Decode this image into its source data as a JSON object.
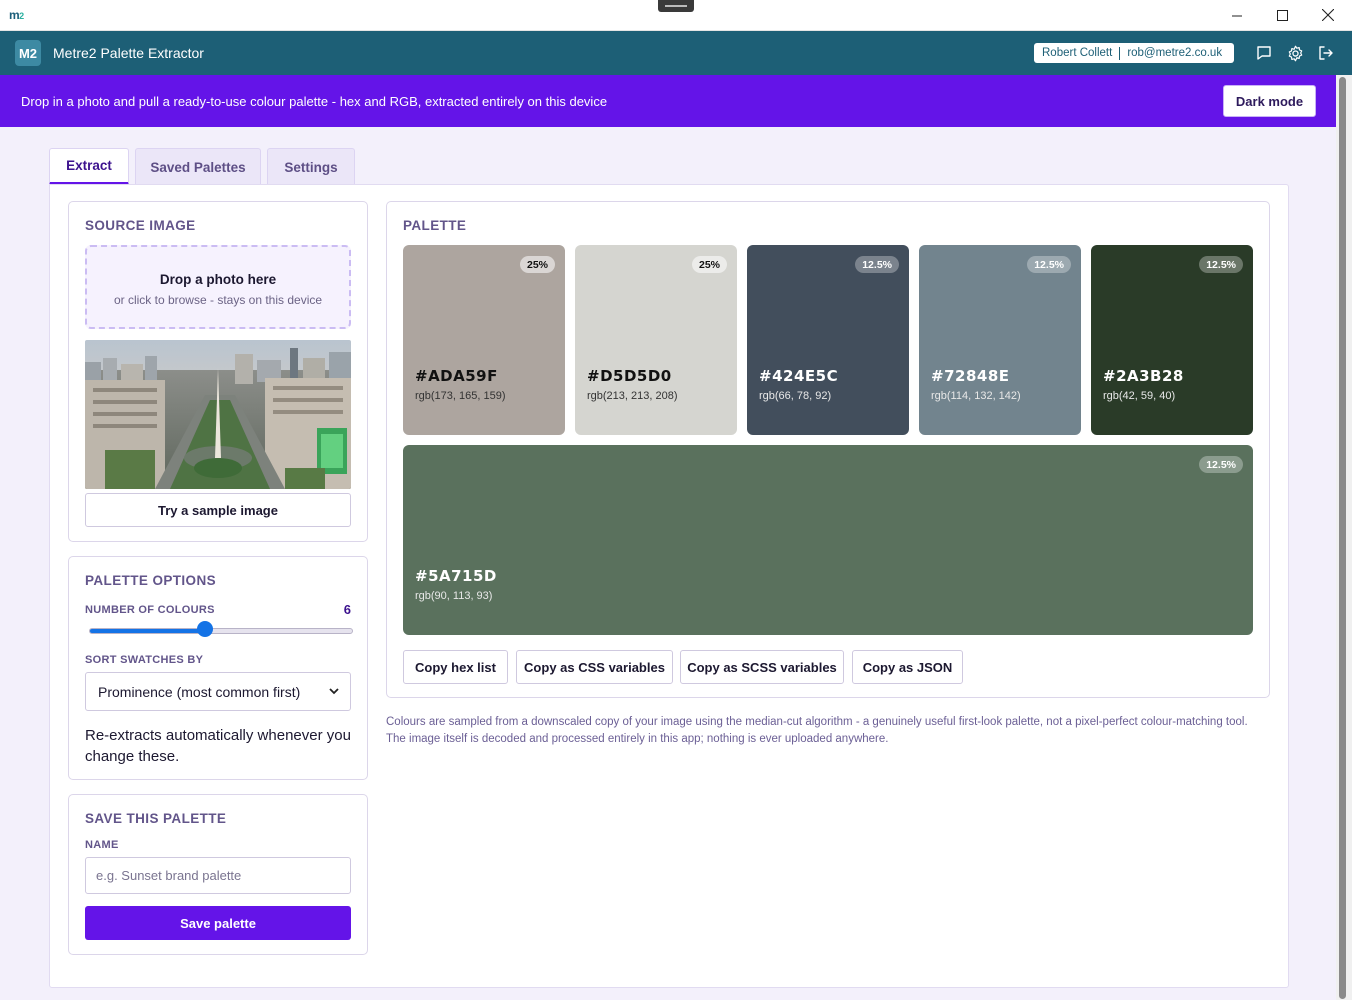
{
  "window": {
    "logo_main": "m",
    "logo_sub": "2"
  },
  "app": {
    "badge": "M2",
    "title": "Metre2 Palette Extractor"
  },
  "user": {
    "name": "Robert Collett",
    "email": "rob@metre2.co.uk"
  },
  "banner": {
    "text": "Drop in a photo and pull a ready-to-use colour palette - hex and RGB, extracted entirely on this device",
    "dark_mode_label": "Dark mode"
  },
  "tabs": [
    {
      "label": "Extract",
      "active": true
    },
    {
      "label": "Saved Palettes",
      "active": false
    },
    {
      "label": "Settings",
      "active": false
    }
  ],
  "source": {
    "title": "SOURCE IMAGE",
    "drop_title": "Drop a photo here",
    "drop_sub": "or click to browse - stays on this device",
    "sample_label": "Try a sample image"
  },
  "options": {
    "title": "PALETTE OPTIONS",
    "count_label": "NUMBER OF COLOURS",
    "count_value": "6",
    "count_fraction": 0.44,
    "sort_label": "SORT SWATCHES BY",
    "sort_value": "Prominence (most common first)",
    "hint": "Re-extracts automatically whenever you change these."
  },
  "save": {
    "title": "SAVE THIS PALETTE",
    "name_label": "NAME",
    "name_placeholder": "e.g. Sunset brand palette",
    "button": "Save palette"
  },
  "palette": {
    "title": "PALETTE",
    "swatches": [
      {
        "hex": "#ADA59F",
        "rgb": "rgb(173, 165, 159)",
        "pct": "25%",
        "color": "#ADA59F",
        "tone": "light"
      },
      {
        "hex": "#D5D5D0",
        "rgb": "rgb(213, 213, 208)",
        "pct": "25%",
        "color": "#D5D5D0",
        "tone": "light"
      },
      {
        "hex": "#424E5C",
        "rgb": "rgb(66, 78, 92)",
        "pct": "12.5%",
        "color": "#424E5C",
        "tone": "dark"
      },
      {
        "hex": "#72848E",
        "rgb": "rgb(114, 132, 142)",
        "pct": "12.5%",
        "color": "#72848E",
        "tone": "dark"
      },
      {
        "hex": "#2A3B28",
        "rgb": "rgb(42, 59, 40)",
        "pct": "12.5%",
        "color": "#2A3B28",
        "tone": "dark"
      },
      {
        "hex": "#5A715D",
        "rgb": "rgb(90, 113, 93)",
        "pct": "12.5%",
        "color": "#5A715D",
        "tone": "dark"
      }
    ],
    "actions": [
      "Copy hex list",
      "Copy as CSS variables",
      "Copy as SCSS variables",
      "Copy as JSON"
    ]
  },
  "footnote": {
    "line1": "Colours are sampled from a downscaled copy of your image using the median-cut algorithm - a genuinely useful first-look palette, not a pixel-perfect colour-matching tool.",
    "line2": "The image itself is decoded and processed entirely in this app; nothing is ever uploaded anywhere."
  },
  "colors": {
    "header": "#1d5f76",
    "accent": "#6414e8",
    "slider": "#1473e6"
  }
}
